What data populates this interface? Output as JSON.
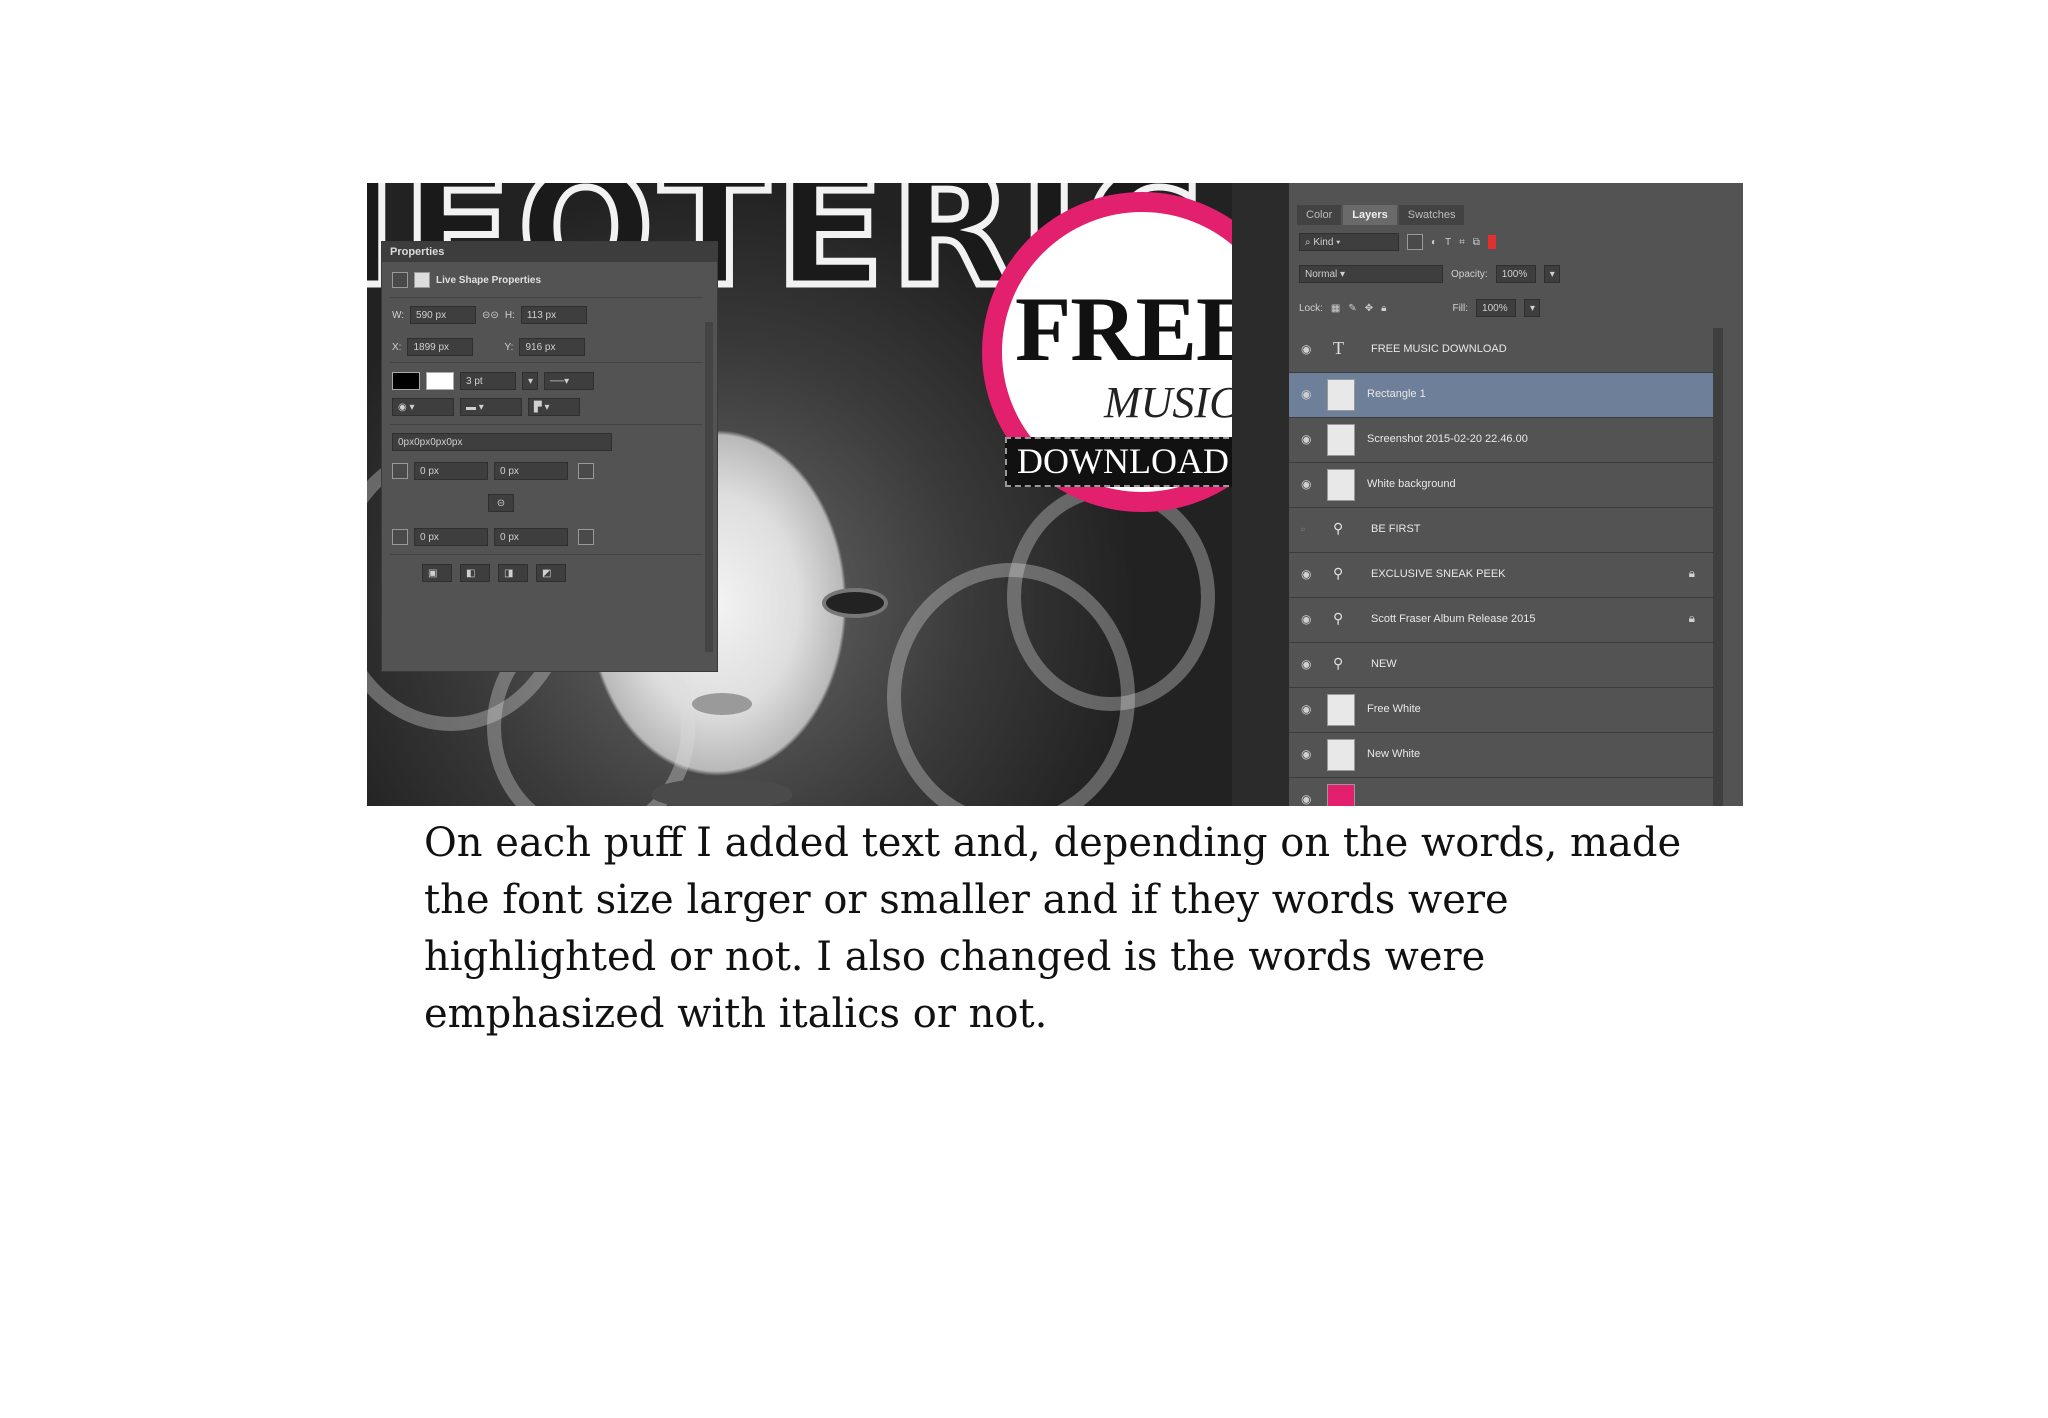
{
  "photo": {
    "masthead": "IEOTERIC",
    "puff": {
      "line1": "FREE",
      "line2": "MUSIC",
      "line3": "DOWNLOAD",
      "accent": "#e2206e"
    }
  },
  "properties_panel": {
    "title": "Properties",
    "section": "Live Shape Properties",
    "w_label": "W:",
    "w_value": "590 px",
    "h_label": "H:",
    "h_value": "113 px",
    "x_label": "X:",
    "x_value": "1899 px",
    "y_label": "Y:",
    "y_value": "916 px",
    "stroke_width": "3 pt",
    "corner_radii": "0px0px0px0px",
    "r1": "0 px",
    "r2": "0 px",
    "r3": "0 px",
    "r4": "0 px"
  },
  "layers_panel": {
    "tabs": [
      "Color",
      "Layers",
      "Swatches"
    ],
    "active_tab": "Layers",
    "filter": "Kind",
    "blend_mode": "Normal",
    "opacity_label": "Opacity:",
    "opacity_value": "100%",
    "lock_label": "Lock:",
    "fill_label": "Fill:",
    "fill_value": "100%",
    "layers": [
      {
        "name": "FREE MUSIC  DOWNLOAD",
        "kind": "text"
      },
      {
        "name": "Rectangle 1",
        "kind": "shape",
        "selected": true
      },
      {
        "name": "Screenshot 2015-02-20 22.46.00",
        "kind": "image"
      },
      {
        "name": "White background",
        "kind": "image"
      },
      {
        "name": "BE FIRST",
        "kind": "smart"
      },
      {
        "name": "EXCLUSIVE SNEAK PEEK",
        "kind": "smart",
        "locked": true
      },
      {
        "name": "Scott Fraser Album Release 2015",
        "kind": "smart",
        "locked": true
      },
      {
        "name": "NEW",
        "kind": "smart"
      },
      {
        "name": "Free White",
        "kind": "shape"
      },
      {
        "name": "New White",
        "kind": "shape"
      }
    ],
    "selected_color": "#6e7f9a"
  },
  "caption": "On each puff I added text and, depending on the words, made the font size larger or smaller and if they words were highlighted or not. I also changed is the words were emphasized with italics or not."
}
